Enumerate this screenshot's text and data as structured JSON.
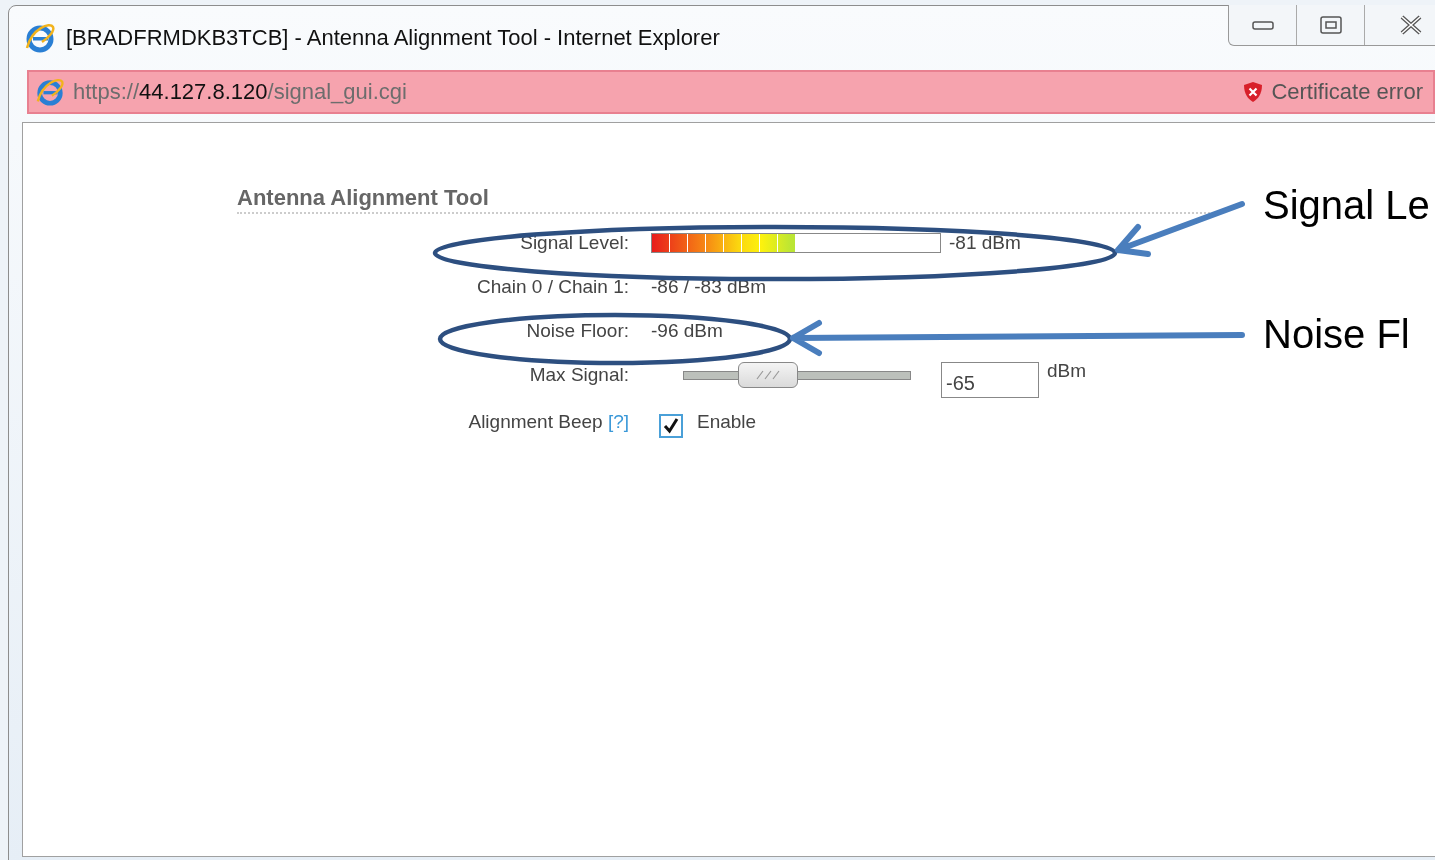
{
  "window": {
    "title": "[BRADFRMDKB3TCB] - Antenna Alignment Tool - Internet Explorer"
  },
  "address_bar": {
    "scheme": "https://",
    "host": "44.127.8.120",
    "path": "/signal_gui.cgi",
    "certificate_error": true,
    "status": "Certificate error"
  },
  "page": {
    "heading": "Antenna Alignment Tool",
    "rows": [
      {
        "kind": "meter",
        "label": "Signal Level:",
        "level": 0.5,
        "reading": "-81 dBm"
      },
      {
        "kind": "text",
        "label": "Chain 0 / Chain 1:",
        "value": "-86 / -83 dBm"
      },
      {
        "kind": "text",
        "label": "Noise Floor:",
        "value": "-96 dBm"
      },
      {
        "kind": "slider",
        "label": "Max Signal:",
        "level": 0.33,
        "value": "-65",
        "unit": "dBm"
      },
      {
        "kind": "checkbox",
        "label": "Alignment Beep",
        "help": "[?]",
        "checked": true,
        "option": "Enable"
      }
    ]
  },
  "annotations": [
    {
      "label": "Signal Le"
    },
    {
      "label": "Noise Fl"
    }
  ]
}
